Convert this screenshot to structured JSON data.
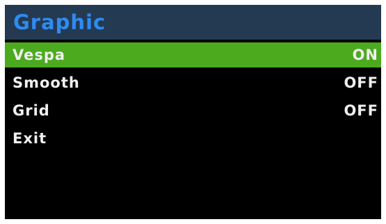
{
  "header": {
    "title": "Graphic"
  },
  "menu": {
    "items": [
      {
        "label": "Vespa",
        "value": "ON",
        "selected": true
      },
      {
        "label": "Smooth",
        "value": "OFF",
        "selected": false
      },
      {
        "label": "Grid",
        "value": "OFF",
        "selected": false
      },
      {
        "label": "Exit",
        "value": "",
        "selected": false
      }
    ]
  },
  "colors": {
    "header_bg": "#243a52",
    "title_text": "#2e8bf0",
    "selection_bg": "#4caa1f",
    "screen_bg": "#000000",
    "item_text": "#f0f0f0"
  }
}
